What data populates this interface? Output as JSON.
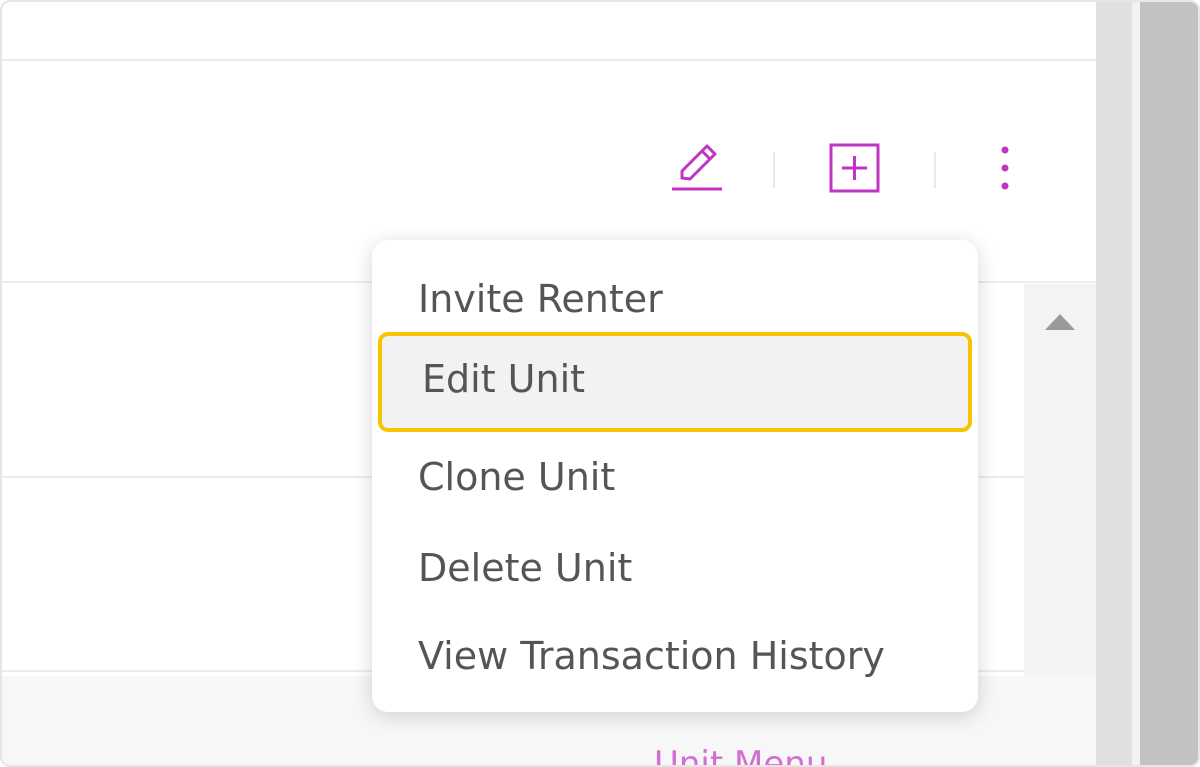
{
  "toolbar": {
    "edit_icon": "pencil-icon",
    "add_icon": "plus-square-icon",
    "more_icon": "vertical-ellipsis-icon",
    "accent_color": "#c333c3"
  },
  "unit_menu": {
    "items": [
      {
        "label": "Invite Renter"
      },
      {
        "label": "Edit Unit",
        "highlighted": true
      },
      {
        "label": "Clone Unit"
      },
      {
        "label": "Delete Unit"
      },
      {
        "label": "View Transaction History"
      }
    ],
    "highlight_color": "#f6c400"
  },
  "footer": {
    "unit_menu_link": "Unit Menu ⌄"
  }
}
